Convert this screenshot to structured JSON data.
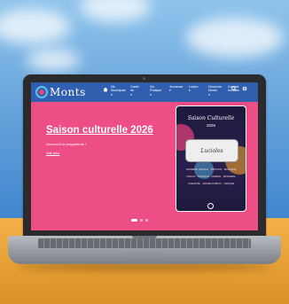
{
  "site": {
    "logo_text": "Monts",
    "nav": [
      {
        "line1": "Vie",
        "line2": "Municipale"
      },
      {
        "line1": "Cadre",
        "line2": "de"
      },
      {
        "line1": "Vie",
        "line2": "Pratique"
      },
      {
        "line1": "Jeunesse",
        "line2": ""
      },
      {
        "line1": "Loisirs",
        "line2": ""
      },
      {
        "line1": "Découvrir",
        "line2": "Monts"
      },
      {
        "line1": "Contact",
        "line2": "horaires"
      }
    ]
  },
  "hero": {
    "title": "Saison culturelle 2026",
    "subtitle": "Découvrir le programme !",
    "link": "Voir plus",
    "poster": {
      "title": "Saison Culturelle",
      "year": "2026",
      "brand": "Lucioles",
      "lines": [
        "NUMERO CECILE · TRISTAN · MORGAN",
        "POLKA · MORALE · DIABLE · MOLIERE",
        "THEATRE · JEUNE PUBLIC · CIRQUE"
      ]
    },
    "slides": {
      "count": 3,
      "active": 1
    }
  },
  "colors": {
    "nav": "#2f5fae",
    "hero": "#ee4e86",
    "accent": "#58c4e8"
  }
}
